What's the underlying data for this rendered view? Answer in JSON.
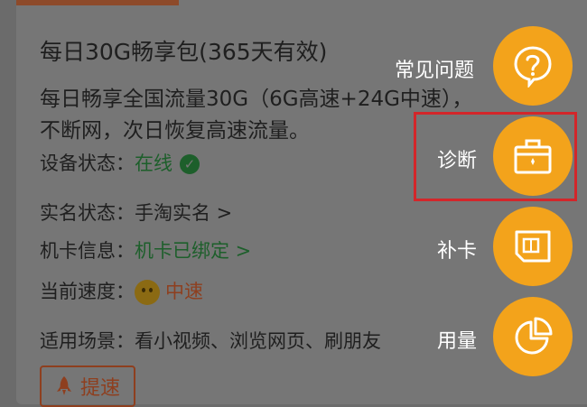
{
  "plan": {
    "title": "每日30G畅享包(365天有效)",
    "desc_line1": "每日畅享全国流量30G（6G高速+24G中速），",
    "desc_line2": "不断网，次日恢复高速流量。"
  },
  "info_rows": [
    {
      "label": "设备状态：",
      "value": "在线"
    },
    {
      "label": "实名状态：",
      "value": "手淘实名 >"
    },
    {
      "label": "机卡信息：",
      "value": "机卡已绑定 >"
    },
    {
      "label": "当前速度：",
      "value": "中速"
    },
    {
      "label": "适用场景：",
      "value": "看小视频、浏览网页、刷朋友"
    }
  ],
  "boost_button": {
    "label": "提速"
  },
  "fab_menu": [
    {
      "label": "常见问题",
      "icon": "question-icon"
    },
    {
      "label": "诊断",
      "icon": "toolbox-icon"
    },
    {
      "label": "补卡",
      "icon": "sim-card-icon"
    },
    {
      "label": "用量",
      "icon": "pie-chart-icon"
    }
  ],
  "colors": {
    "accent_orange": "#f3a31b",
    "highlight_red": "#d3262a",
    "online_green": "#1d5f2b"
  }
}
